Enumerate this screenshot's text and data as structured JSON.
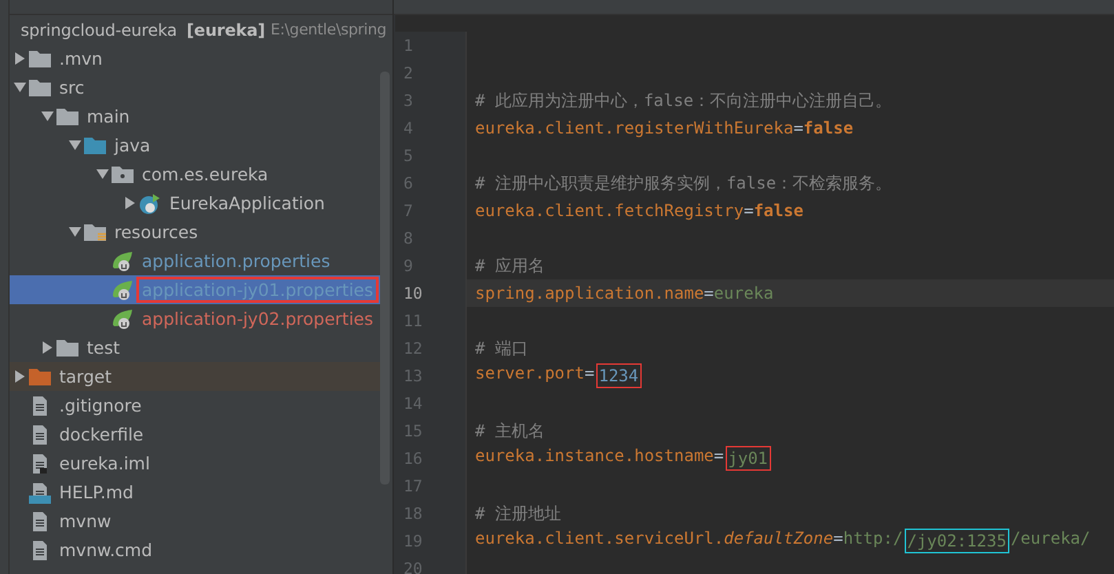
{
  "project_tree": {
    "root": {
      "label": "springcloud-eureka",
      "module": "[eureka]",
      "path": "E:\\gentle\\spring"
    },
    "items": [
      {
        "label": ".mvn",
        "kind": "folder",
        "expanded": false,
        "selected": false,
        "color": "#bbbbbb"
      },
      {
        "label": "src",
        "kind": "folder",
        "expanded": true,
        "selected": false,
        "color": "#bbbbbb",
        "children": [
          {
            "label": "main",
            "kind": "folder",
            "expanded": true,
            "selected": false,
            "color": "#bbbbbb",
            "children": [
              {
                "label": "java",
                "kind": "source-folder",
                "expanded": true,
                "selected": false,
                "color": "#bbbbbb",
                "children": [
                  {
                    "label": "com.es.eureka",
                    "kind": "package",
                    "expanded": true,
                    "selected": false,
                    "color": "#bbbbbb",
                    "children": [
                      {
                        "label": "EurekaApplication",
                        "kind": "class",
                        "expanded": false,
                        "selected": false,
                        "color": "#bbbbbb"
                      }
                    ]
                  }
                ]
              },
              {
                "label": "resources",
                "kind": "resources-folder",
                "expanded": true,
                "selected": false,
                "color": "#bbbbbb",
                "children": [
                  {
                    "label": "application.properties",
                    "kind": "properties",
                    "selected": false,
                    "color": "#6897bb",
                    "outlined": false
                  },
                  {
                    "label": "application-jy01.properties",
                    "kind": "properties",
                    "selected": true,
                    "color": "#6897bb",
                    "outlined": true
                  },
                  {
                    "label": "application-jy02.properties",
                    "kind": "properties",
                    "selected": false,
                    "color": "#d1675a",
                    "outlined": false
                  }
                ]
              }
            ]
          },
          {
            "label": "test",
            "kind": "folder",
            "expanded": false,
            "selected": false,
            "color": "#bbbbbb"
          }
        ]
      },
      {
        "label": "target",
        "kind": "excluded-folder",
        "expanded": false,
        "selected": false,
        "color": "#bbbbbb"
      },
      {
        "label": ".gitignore",
        "kind": "file",
        "selected": false,
        "color": "#bbbbbb"
      },
      {
        "label": "dockerfile",
        "kind": "file",
        "selected": false,
        "color": "#bbbbbb"
      },
      {
        "label": "eureka.iml",
        "kind": "iml",
        "selected": false,
        "color": "#bbbbbb"
      },
      {
        "label": "HELP.md",
        "kind": "markdown",
        "selected": false,
        "color": "#bbbbbb"
      },
      {
        "label": "mvnw",
        "kind": "file",
        "selected": false,
        "color": "#bbbbbb"
      },
      {
        "label": "mvnw.cmd",
        "kind": "file",
        "selected": false,
        "color": "#bbbbbb"
      }
    ]
  },
  "editor": {
    "lines": [
      {
        "number": "1",
        "current": false
      },
      {
        "number": "2",
        "current": false
      },
      {
        "number": "3",
        "current": false,
        "segments": [
          {
            "kind": "comment",
            "text": "# 此应用为注册中心，false：不向注册中心注册自己。"
          }
        ]
      },
      {
        "number": "4",
        "current": false,
        "segments": [
          {
            "kind": "key",
            "text": "eureka.client.registerWithEureka"
          },
          {
            "kind": "sep",
            "text": "="
          },
          {
            "kind": "keyword",
            "text": "false"
          }
        ]
      },
      {
        "number": "5",
        "current": false
      },
      {
        "number": "6",
        "current": false,
        "segments": [
          {
            "kind": "comment",
            "text": "# 注册中心职责是维护服务实例，false：不检索服务。"
          }
        ]
      },
      {
        "number": "7",
        "current": false,
        "segments": [
          {
            "kind": "key",
            "text": "eureka.client.fetchRegistry"
          },
          {
            "kind": "sep",
            "text": "="
          },
          {
            "kind": "keyword",
            "text": "false"
          }
        ]
      },
      {
        "number": "8",
        "current": false
      },
      {
        "number": "9",
        "current": false,
        "segments": [
          {
            "kind": "comment",
            "text": "# 应用名"
          }
        ]
      },
      {
        "number": "10",
        "current": true,
        "segments": [
          {
            "kind": "key",
            "text": "spring.application.name"
          },
          {
            "kind": "sep",
            "text": "="
          },
          {
            "kind": "string",
            "text": "eureka"
          }
        ]
      },
      {
        "number": "11",
        "current": false
      },
      {
        "number": "12",
        "current": false,
        "segments": [
          {
            "kind": "comment",
            "text": "# 端口"
          }
        ]
      },
      {
        "number": "13",
        "current": false,
        "segments": [
          {
            "kind": "key",
            "text": "server.port"
          },
          {
            "kind": "sep",
            "text": "="
          },
          {
            "kind": "number",
            "text": "1234",
            "color": "#e53935"
          }
        ]
      },
      {
        "number": "14",
        "current": false
      },
      {
        "number": "15",
        "current": false,
        "segments": [
          {
            "kind": "comment",
            "text": "# 主机名"
          }
        ]
      },
      {
        "number": "16",
        "current": false,
        "segments": [
          {
            "kind": "key",
            "text": "eureka.instance.hostname"
          },
          {
            "kind": "sep",
            "text": "="
          },
          {
            "kind": "string",
            "text": "jy01",
            "color": "#e53935"
          }
        ]
      },
      {
        "number": "17",
        "current": false
      },
      {
        "number": "18",
        "current": false,
        "segments": [
          {
            "kind": "comment",
            "text": "# 注册地址"
          }
        ]
      },
      {
        "number": "19",
        "current": false,
        "segments": [
          {
            "kind": "key",
            "text": "eureka.client.serviceUrl."
          },
          {
            "kind": "italic-key",
            "text": "defaultZone"
          },
          {
            "kind": "sep",
            "text": "="
          },
          {
            "kind": "string",
            "text": "http:/"
          },
          {
            "kind": "string",
            "text": "/jy02:1235",
            "color": "#20c4d4"
          },
          {
            "kind": "string",
            "text": "/eureka/"
          }
        ]
      },
      {
        "number": "20",
        "current": false
      }
    ]
  }
}
